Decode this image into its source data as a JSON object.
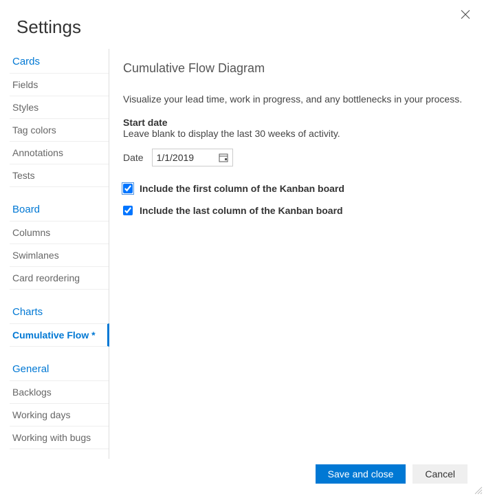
{
  "dialogTitle": "Settings",
  "sidebar": {
    "groups": [
      {
        "header": "Cards",
        "items": [
          {
            "label": "Fields"
          },
          {
            "label": "Styles"
          },
          {
            "label": "Tag colors"
          },
          {
            "label": "Annotations"
          },
          {
            "label": "Tests"
          }
        ]
      },
      {
        "header": "Board",
        "items": [
          {
            "label": "Columns"
          },
          {
            "label": "Swimlanes"
          },
          {
            "label": "Card reordering"
          }
        ]
      },
      {
        "header": "Charts",
        "items": [
          {
            "label": "Cumulative Flow *",
            "active": true
          }
        ]
      },
      {
        "header": "General",
        "items": [
          {
            "label": "Backlogs"
          },
          {
            "label": "Working days"
          },
          {
            "label": "Working with bugs"
          }
        ]
      }
    ]
  },
  "content": {
    "title": "Cumulative Flow Diagram",
    "description": "Visualize your lead time, work in progress, and any bottlenecks in your process.",
    "startDateLabel": "Start date",
    "startDateHint": "Leave blank to display the last 30 weeks of activity.",
    "dateLabel": "Date",
    "dateValue": "1/1/2019",
    "includeFirstLabel": "Include the first column of the Kanban board",
    "includeLastLabel": "Include the last column of the Kanban board"
  },
  "footer": {
    "saveLabel": "Save and close",
    "cancelLabel": "Cancel"
  }
}
